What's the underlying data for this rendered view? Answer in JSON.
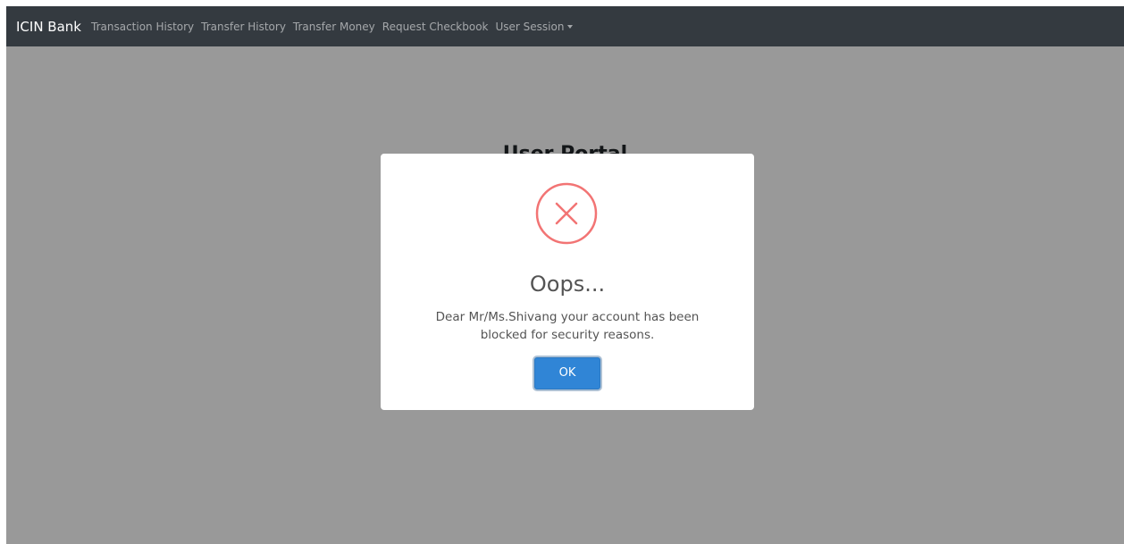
{
  "navbar": {
    "brand": "ICIN Bank",
    "links": [
      {
        "label": "Transaction History"
      },
      {
        "label": "Transfer History"
      },
      {
        "label": "Transfer Money"
      },
      {
        "label": "Request Checkbook"
      }
    ],
    "dropdown": {
      "label": "User Session"
    }
  },
  "page": {
    "title": "User Portal"
  },
  "dialog": {
    "icon": "error-x-icon",
    "title": "Oops...",
    "message": "Dear Mr/Ms.Shivang your account has been blocked for security reasons.",
    "confirm_label": "OK"
  },
  "colors": {
    "navbar_bg": "#343a40",
    "error": "#f27474",
    "confirm_button": "#3085d6"
  }
}
